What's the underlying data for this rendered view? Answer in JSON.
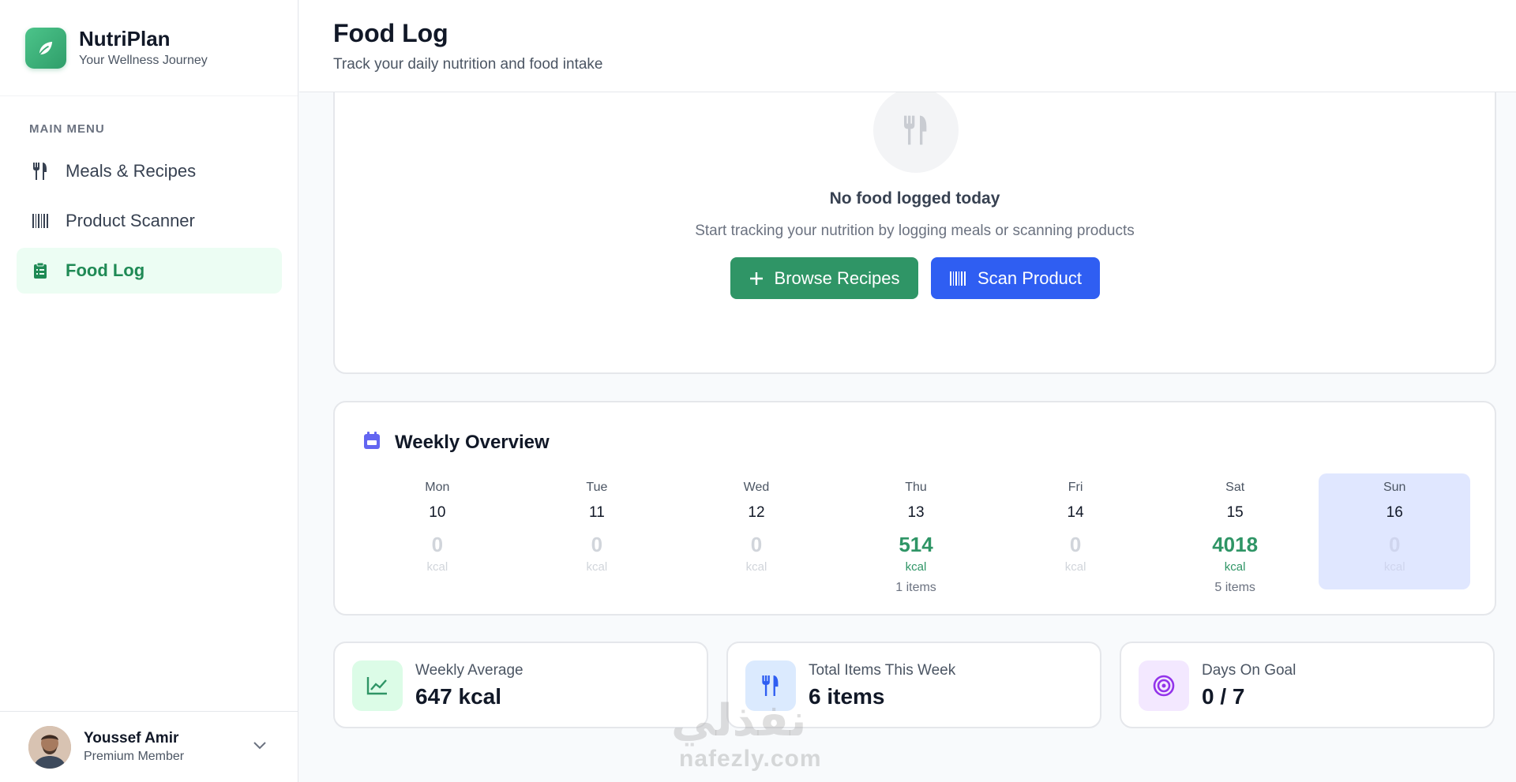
{
  "brand": {
    "name": "NutriPlan",
    "tagline": "Your Wellness Journey",
    "accent": "#2f9566"
  },
  "sidebar": {
    "heading": "MAIN MENU",
    "items": [
      {
        "label": "Meals & Recipes",
        "icon": "utensils-icon",
        "active": false
      },
      {
        "label": "Product Scanner",
        "icon": "barcode-icon",
        "active": false
      },
      {
        "label": "Food Log",
        "icon": "clipboard-list-icon",
        "active": true
      }
    ]
  },
  "user": {
    "name": "Youssef Amir",
    "role": "Premium Member"
  },
  "header": {
    "title": "Food Log",
    "subtitle": "Track your daily nutrition and food intake"
  },
  "empty": {
    "title": "No food logged today",
    "subtitle": "Start tracking your nutrition by logging meals or scanning products",
    "browse_label": "Browse Recipes",
    "scan_label": "Scan Product"
  },
  "weekly": {
    "title": "Weekly Overview",
    "days": [
      {
        "name": "Mon",
        "date": "10",
        "kcal": "0",
        "unit": "kcal",
        "items": ""
      },
      {
        "name": "Tue",
        "date": "11",
        "kcal": "0",
        "unit": "kcal",
        "items": ""
      },
      {
        "name": "Wed",
        "date": "12",
        "kcal": "0",
        "unit": "kcal",
        "items": ""
      },
      {
        "name": "Thu",
        "date": "13",
        "kcal": "514",
        "unit": "kcal",
        "items": "1 items"
      },
      {
        "name": "Fri",
        "date": "14",
        "kcal": "0",
        "unit": "kcal",
        "items": ""
      },
      {
        "name": "Sat",
        "date": "15",
        "kcal": "4018",
        "unit": "kcal",
        "items": "5 items"
      },
      {
        "name": "Sun",
        "date": "16",
        "kcal": "0",
        "unit": "kcal",
        "items": ""
      }
    ]
  },
  "stats": [
    {
      "label": "Weekly Average",
      "value": "647 kcal",
      "icon": "chart-line-icon"
    },
    {
      "label": "Total Items This Week",
      "value": "6 items",
      "icon": "utensils-icon"
    },
    {
      "label": "Days On Goal",
      "value": "0 / 7",
      "icon": "target-icon"
    }
  ],
  "watermark": {
    "latin": "nafezly.com",
    "arabic": "نفذلي"
  }
}
